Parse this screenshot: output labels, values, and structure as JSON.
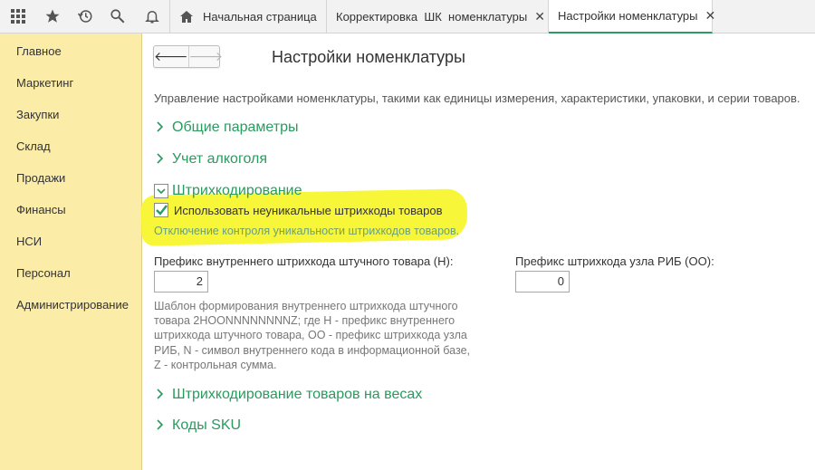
{
  "topbar": {
    "icons": [
      "apps-grid-icon",
      "star-icon",
      "history-icon",
      "search-icon",
      "bell-icon"
    ],
    "tabs": [
      {
        "label": "Начальная страница",
        "icon": "home-icon"
      },
      {
        "label": "Корректировка  ШК  номенклатуры",
        "close": "✕"
      },
      {
        "label": "Настройки номенклатуры",
        "close": "✕",
        "active": true
      }
    ]
  },
  "sidebar": {
    "items": [
      {
        "label": "Главное"
      },
      {
        "label": "Маркетинг"
      },
      {
        "label": "Закупки"
      },
      {
        "label": "Склад"
      },
      {
        "label": "Продажи"
      },
      {
        "label": "Финансы"
      },
      {
        "label": "НСИ"
      },
      {
        "label": "Персонал"
      },
      {
        "label": "Администрирование"
      }
    ]
  },
  "main": {
    "nav": {
      "back": "🡐",
      "forward": "🡒"
    },
    "title": "Настройки номенклатуры",
    "description": "Управление настройками номенклатуры, такими как единицы измерения, характеристики, упаковки, и серии товаров.",
    "sections": {
      "general": "Общие параметры",
      "alcohol": "Учет алкоголя",
      "barcoding": "Штрихкодирование",
      "weight_barcoding": "Штрихкодирование товаров на весах",
      "sku": "Коды SKU"
    },
    "barcoding": {
      "checkbox_label": "Использовать неуникальные штрихкоды товаров",
      "checkbox_checked": true,
      "hint": "Отключение контроля уникальности штрихкодов товаров.",
      "internal_prefix_label": "Префикс внутреннего штрихкода штучного товара (Н):",
      "internal_prefix_value": "2",
      "rib_prefix_label": "Префикс штрихкода узла РИБ (ОО):",
      "rib_prefix_value": "0",
      "template_note": "Шаблон формирования внутреннего штрихкода штучного товара 2НООNNNNNNNNZ; где Н - префикс внутреннего штрихкода штучного товара, ОО - префикс штрихкода узла РИБ, N - символ внутреннего кода в информационной базе, Z - контрольная сумма."
    },
    "colors": {
      "accent": "#2a9a5e",
      "sidebar_bg": "#fbeca8",
      "highlight": "#f8f52e"
    }
  }
}
